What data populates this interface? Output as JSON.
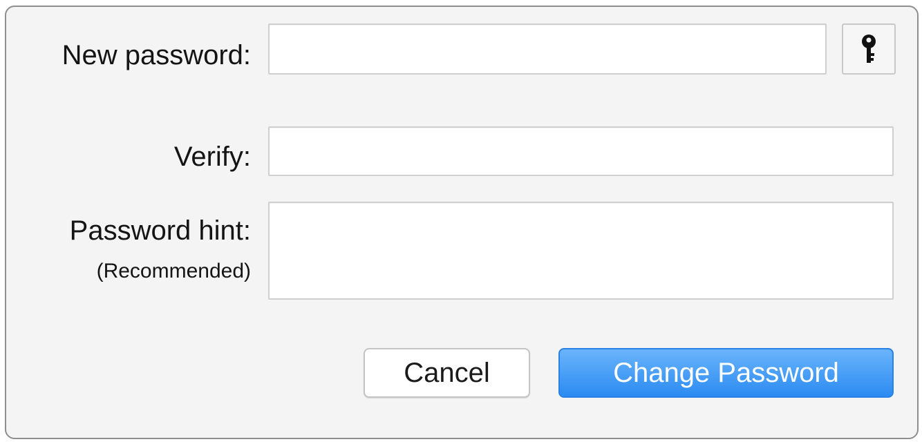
{
  "dialog": {
    "new_password": {
      "label": "New password:",
      "value": "",
      "key_button_icon": "key-icon"
    },
    "verify": {
      "label": "Verify:",
      "value": ""
    },
    "hint": {
      "label": "Password hint:",
      "sublabel": "(Recommended)",
      "value": ""
    },
    "buttons": {
      "cancel_label": "Cancel",
      "change_label": "Change Password"
    },
    "colors": {
      "primary_button": "#2b8bf2",
      "dialog_background": "#f4f4f4"
    }
  }
}
